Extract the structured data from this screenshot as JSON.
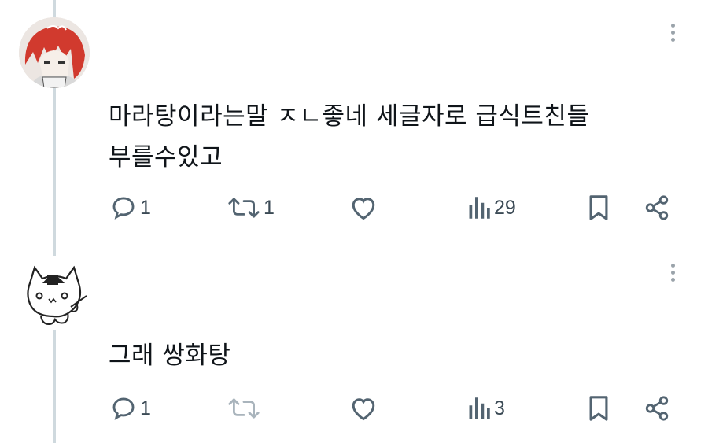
{
  "tweets": [
    {
      "text_line1": "마라탕이라는말 ㅈㄴ좋네 세글자로 급식트친들",
      "text_line2": "부를수있고",
      "replies": "1",
      "retweets": "1",
      "views": "29",
      "avatar": "red-haired-anime-avatar"
    },
    {
      "text_line1": "그래 쌍화탕",
      "replies": "1",
      "views": "3",
      "avatar": "cat-doodle-avatar"
    }
  ],
  "colors": {
    "icon": "#536471",
    "icon_disabled": "#a9b4bc",
    "thread_line": "#cfd9de",
    "text": "#0f1419"
  }
}
